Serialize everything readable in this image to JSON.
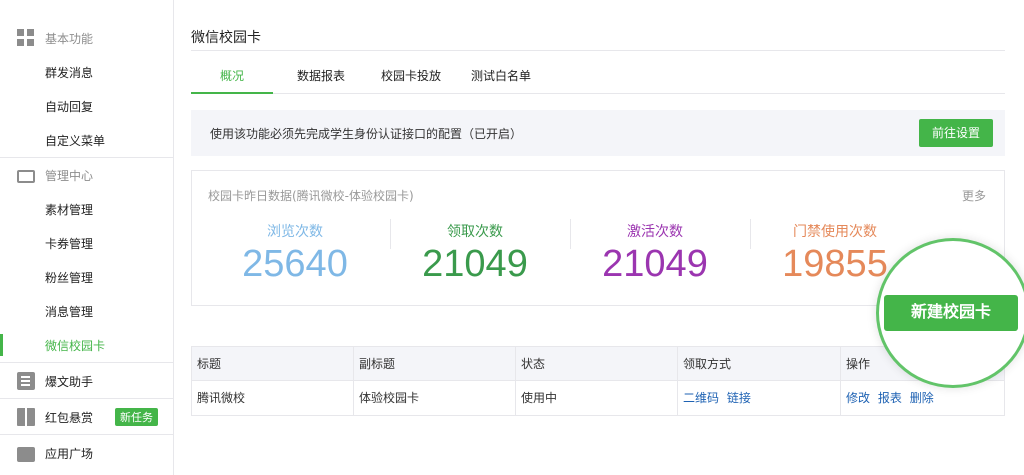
{
  "sidebar": {
    "groups": [
      {
        "label": "基本功能",
        "icon": "grid-icon"
      },
      {
        "label": "管理中心",
        "icon": "tray-icon"
      },
      {
        "label": "爆文助手",
        "icon": "document-icon"
      },
      {
        "label": "红包悬赏",
        "icon": "gift-icon",
        "badge": "新任务"
      },
      {
        "label": "应用广场",
        "icon": "bag-icon"
      }
    ],
    "basic_items": [
      "群发消息",
      "自动回复",
      "自定义菜单"
    ],
    "manage_items": [
      "素材管理",
      "卡券管理",
      "粉丝管理",
      "消息管理",
      "微信校园卡"
    ],
    "active_item": "微信校园卡"
  },
  "main": {
    "title": "微信校园卡",
    "tabs": [
      "概况",
      "数据报表",
      "校园卡投放",
      "测试白名单"
    ],
    "active_tab": "概况",
    "notice": {
      "text": "使用该功能必须先完成学生身份认证接口的配置（已开启）",
      "button": "前往设置"
    },
    "stats": {
      "title": "校园卡昨日数据(腾讯微校-体验校园卡)",
      "more": "更多",
      "items": [
        {
          "label": "浏览次数",
          "value": "25640",
          "color": "#7fb8e6"
        },
        {
          "label": "领取次数",
          "value": "21049",
          "color": "#3a9a4c"
        },
        {
          "label": "激活次数",
          "value": "21049",
          "color": "#9b35b0"
        },
        {
          "label": "门禁使用次数",
          "value": "19855",
          "color": "#e5895a"
        }
      ]
    },
    "new_card_button": "新建校园卡",
    "table": {
      "headers": [
        "标题",
        "副标题",
        "状态",
        "领取方式",
        "操作"
      ],
      "rows": [
        {
          "title": "腾讯微校",
          "subtitle": "体验校园卡",
          "status": "使用中",
          "methods": [
            "二维码",
            "链接"
          ],
          "actions": [
            "修改",
            "报表",
            "删除"
          ]
        }
      ]
    }
  },
  "colors": {
    "accent": "#44b549",
    "link": "#1e62b3"
  }
}
